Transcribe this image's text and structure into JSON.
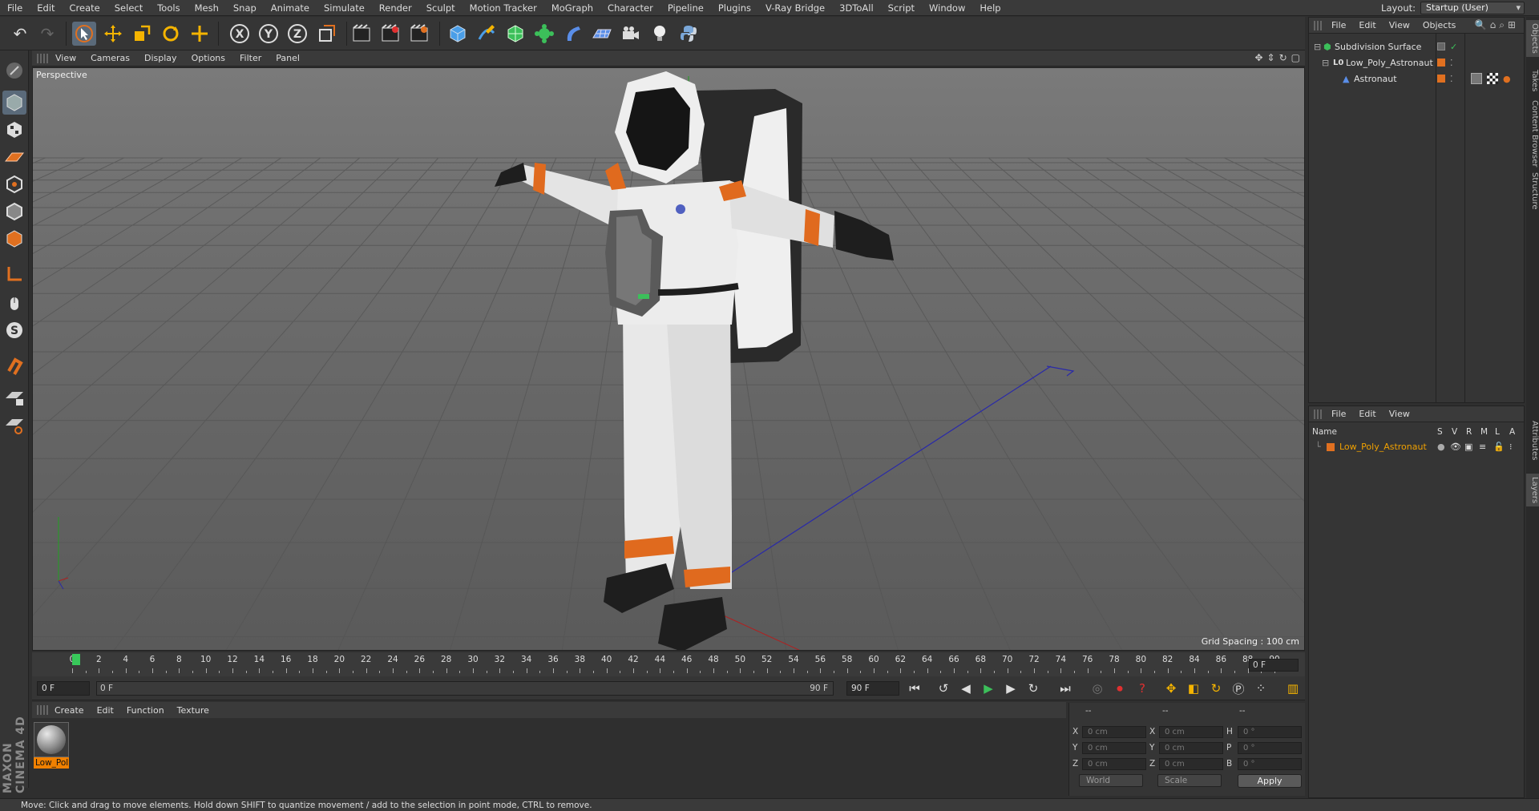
{
  "menubar": [
    "File",
    "Edit",
    "Create",
    "Select",
    "Tools",
    "Mesh",
    "Snap",
    "Animate",
    "Simulate",
    "Render",
    "Sculpt",
    "Motion Tracker",
    "MoGraph",
    "Character",
    "Pipeline",
    "Plugins",
    "V-Ray Bridge",
    "3DToAll",
    "Script",
    "Window",
    "Help"
  ],
  "layout": {
    "label": "Layout:",
    "value": "Startup (User)"
  },
  "viewport": {
    "menu": [
      "View",
      "Cameras",
      "Display",
      "Options",
      "Filter",
      "Panel"
    ],
    "camera_label": "Perspective",
    "grid_spacing": "Grid Spacing : 100 cm"
  },
  "timeline": {
    "ticks": [
      "0",
      "2",
      "4",
      "6",
      "8",
      "10",
      "12",
      "14",
      "16",
      "18",
      "20",
      "22",
      "24",
      "26",
      "28",
      "30",
      "32",
      "34",
      "36",
      "38",
      "40",
      "42",
      "44",
      "46",
      "48",
      "50",
      "52",
      "54",
      "56",
      "58",
      "60",
      "62",
      "64",
      "66",
      "68",
      "70",
      "72",
      "74",
      "76",
      "78",
      "80",
      "82",
      "84",
      "86",
      "88",
      "90"
    ],
    "current_frame_display": "0 F"
  },
  "transport": {
    "start_field": "0 F",
    "range_start": "0 F",
    "range_end": "90 F",
    "end_field": "90 F"
  },
  "material": {
    "menu": [
      "Create",
      "Edit",
      "Function",
      "Texture"
    ],
    "name": "Low_Pol"
  },
  "coords": {
    "headers": [
      "--",
      "--",
      "--"
    ],
    "rows": [
      {
        "a": "X",
        "av": "0 cm",
        "b": "X",
        "bv": "0 cm",
        "c": "H",
        "cv": "0 °"
      },
      {
        "a": "Y",
        "av": "0 cm",
        "b": "Y",
        "bv": "0 cm",
        "c": "P",
        "cv": "0 °"
      },
      {
        "a": "Z",
        "av": "0 cm",
        "b": "Z",
        "bv": "0 cm",
        "c": "B",
        "cv": "0 °"
      }
    ],
    "space": "World",
    "mode": "Scale",
    "apply": "Apply"
  },
  "objects_panel": {
    "menu": [
      "File",
      "Edit",
      "View",
      "Objects"
    ],
    "items": [
      "Subdivision Surface",
      "Low_Poly_Astronaut",
      "Astronaut"
    ]
  },
  "layers_panel": {
    "menu": [
      "File",
      "Edit",
      "View"
    ],
    "columns": [
      "Name",
      "S",
      "V",
      "R",
      "M",
      "L",
      "A"
    ],
    "items": [
      "Low_Poly_Astronaut"
    ]
  },
  "side_tabs": [
    "Objects",
    "Takes",
    "Content Browser",
    "Structure",
    "Attributes",
    "Layers"
  ],
  "status": "Move: Click and drag to move elements. Hold down SHIFT to quantize movement / add to the selection in point mode, CTRL to remove.",
  "brand": "MAXON CINEMA 4D",
  "colors": {
    "accent": "#f08000",
    "selected_text": "#f0a000",
    "frame_cursor": "#38c85a"
  }
}
